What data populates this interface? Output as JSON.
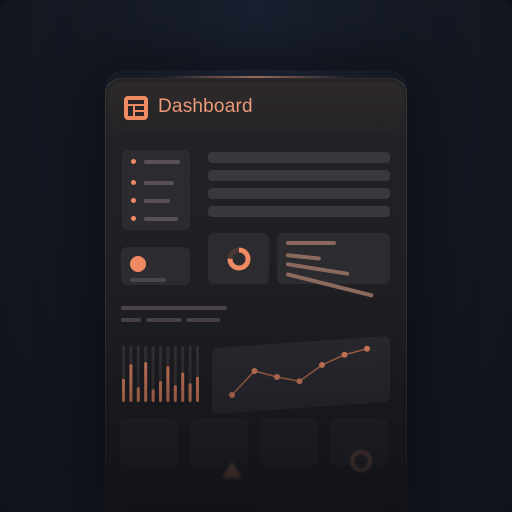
{
  "header": {
    "title": "Dashboard",
    "logo_icon": "dashboard-layout-icon"
  },
  "colors": {
    "accent": "#ef8a62",
    "panel": "#1e1e22",
    "card": "#2b2b30",
    "background": "#141923"
  },
  "sidebar": {
    "items": [
      {
        "icon": "dot-icon"
      },
      {
        "icon": "dot-icon"
      },
      {
        "icon": "dot-icon"
      },
      {
        "icon": "dot-icon"
      }
    ]
  },
  "widgets": {
    "donut": {
      "value_fraction": 0.75
    },
    "bar_chart": {
      "values": [
        0.55,
        0.9,
        0.35,
        0.95,
        0.3,
        0.5,
        0.85,
        0.4,
        0.7,
        0.45,
        0.6
      ]
    },
    "line_chart": {
      "values": [
        0.15,
        0.55,
        0.45,
        0.38,
        0.65,
        0.82,
        0.92
      ]
    }
  }
}
